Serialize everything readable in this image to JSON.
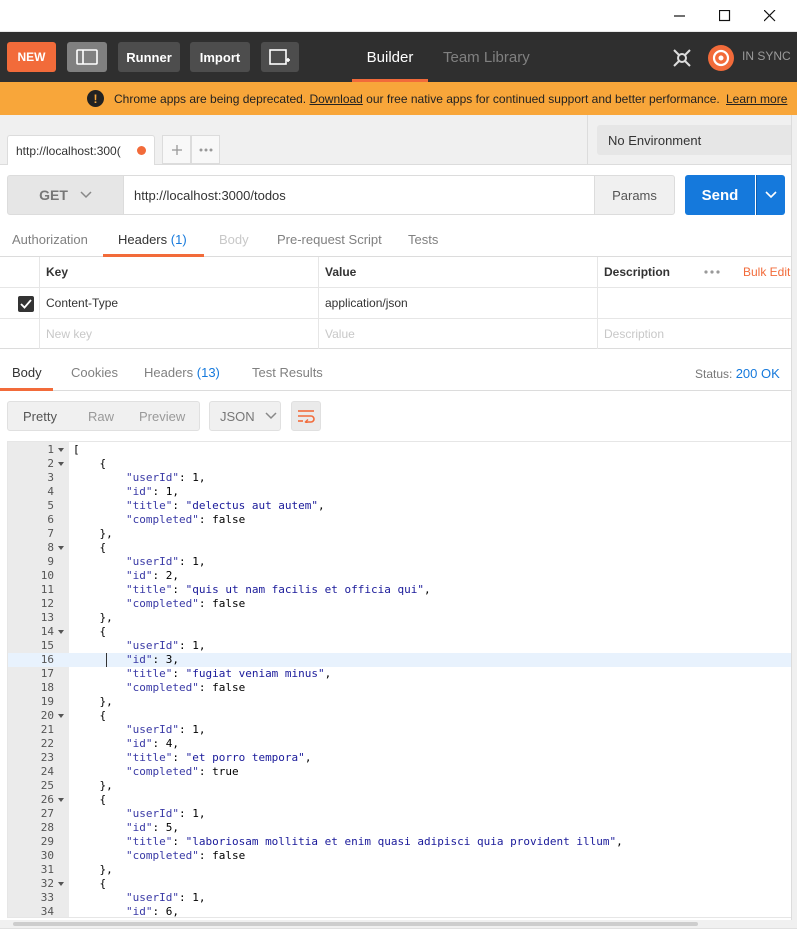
{
  "toolbar": {
    "new_label": "NEW",
    "runner_label": "Runner",
    "import_label": "Import",
    "builder_tab": "Builder",
    "library_tab": "Team Library",
    "sync_status": "IN SYNC",
    "accent": "#f26b3a"
  },
  "banner": {
    "text_before": "Chrome apps are being deprecated. ",
    "download_link": "Download",
    "text_after": " our free native apps for continued support and better performance.",
    "learn_more": "Learn more",
    "color": "#f8a63a"
  },
  "tabs": {
    "request_tab": "http://localhost:300(",
    "environment": "No Environment"
  },
  "request": {
    "method": "GET",
    "url": "http://localhost:3000/todos",
    "params_label": "Params",
    "send_label": "Send",
    "send_color": "#1579dc"
  },
  "request_tabs": {
    "authorization": "Authorization",
    "headers": "Headers",
    "headers_count": "(1)",
    "body": "Body",
    "prerequest": "Pre-request Script",
    "tests": "Tests"
  },
  "headers_table": {
    "col_key": "Key",
    "col_value": "Value",
    "col_description": "Description",
    "bulk_edit": "Bulk Edit",
    "rows": [
      {
        "key": "Content-Type",
        "value": "application/json",
        "description": "",
        "checked": true
      }
    ],
    "new_key_placeholder": "New key",
    "new_value_placeholder": "Value",
    "new_desc_placeholder": "Description"
  },
  "response": {
    "tabs": {
      "body": "Body",
      "cookies": "Cookies",
      "headers": "Headers",
      "headers_count": "(13)",
      "test_results": "Test Results"
    },
    "status_label": "Status:",
    "status_value": "200 OK",
    "format": {
      "pretty": "Pretty",
      "raw": "Raw",
      "preview": "Preview",
      "language": "JSON"
    }
  },
  "code_lines": [
    {
      "n": "1",
      "fold": true,
      "text": "["
    },
    {
      "n": "2",
      "fold": true,
      "text": "    {"
    },
    {
      "n": "3",
      "fold": false,
      "text": "        \"userId\": 1,"
    },
    {
      "n": "4",
      "fold": false,
      "text": "        \"id\": 1,"
    },
    {
      "n": "5",
      "fold": false,
      "text": "        \"title\": \"delectus aut autem\","
    },
    {
      "n": "6",
      "fold": false,
      "text": "        \"completed\": false"
    },
    {
      "n": "7",
      "fold": false,
      "text": "    },"
    },
    {
      "n": "8",
      "fold": true,
      "text": "    {"
    },
    {
      "n": "9",
      "fold": false,
      "text": "        \"userId\": 1,"
    },
    {
      "n": "10",
      "fold": false,
      "text": "        \"id\": 2,"
    },
    {
      "n": "11",
      "fold": false,
      "text": "        \"title\": \"quis ut nam facilis et officia qui\","
    },
    {
      "n": "12",
      "fold": false,
      "text": "        \"completed\": false"
    },
    {
      "n": "13",
      "fold": false,
      "text": "    },"
    },
    {
      "n": "14",
      "fold": true,
      "text": "    {"
    },
    {
      "n": "15",
      "fold": false,
      "text": "        \"userId\": 1,"
    },
    {
      "n": "16",
      "fold": false,
      "text": "        \"id\": 3,",
      "highlight": true
    },
    {
      "n": "17",
      "fold": false,
      "text": "        \"title\": \"fugiat veniam minus\","
    },
    {
      "n": "18",
      "fold": false,
      "text": "        \"completed\": false"
    },
    {
      "n": "19",
      "fold": false,
      "text": "    },"
    },
    {
      "n": "20",
      "fold": true,
      "text": "    {"
    },
    {
      "n": "21",
      "fold": false,
      "text": "        \"userId\": 1,"
    },
    {
      "n": "22",
      "fold": false,
      "text": "        \"id\": 4,"
    },
    {
      "n": "23",
      "fold": false,
      "text": "        \"title\": \"et porro tempora\","
    },
    {
      "n": "24",
      "fold": false,
      "text": "        \"completed\": true"
    },
    {
      "n": "25",
      "fold": false,
      "text": "    },"
    },
    {
      "n": "26",
      "fold": true,
      "text": "    {"
    },
    {
      "n": "27",
      "fold": false,
      "text": "        \"userId\": 1,"
    },
    {
      "n": "28",
      "fold": false,
      "text": "        \"id\": 5,"
    },
    {
      "n": "29",
      "fold": false,
      "text": "        \"title\": \"laboriosam mollitia et enim quasi adipisci quia provident illum\","
    },
    {
      "n": "30",
      "fold": false,
      "text": "        \"completed\": false"
    },
    {
      "n": "31",
      "fold": false,
      "text": "    },"
    },
    {
      "n": "32",
      "fold": true,
      "text": "    {"
    },
    {
      "n": "33",
      "fold": false,
      "text": "        \"userId\": 1,"
    },
    {
      "n": "34",
      "fold": false,
      "text": "        \"id\": 6,"
    }
  ]
}
